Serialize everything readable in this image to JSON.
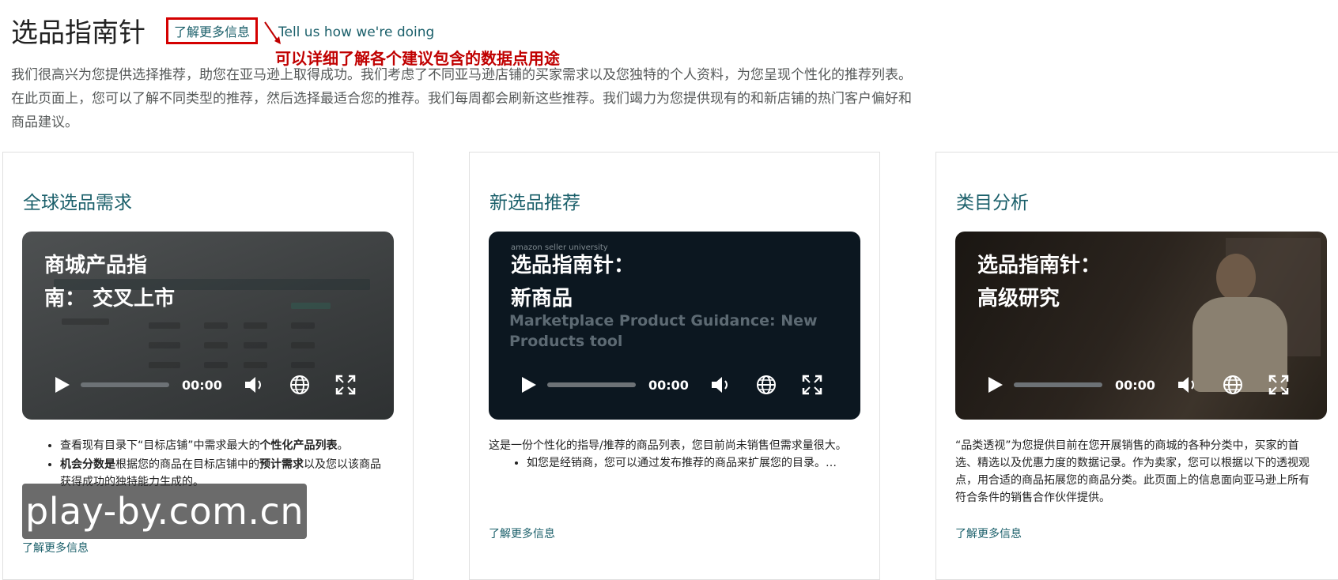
{
  "header": {
    "title": "选品指南针",
    "learn_more": "了解更多信息",
    "tell_us": "Tell us how we're doing",
    "annotation": "可以详细了解各个建议包含的数据点用途",
    "intro": "我们很高兴为您提供选择推荐，助您在亚马逊上取得成功。我们考虑了不同亚马逊店铺的买家需求以及您独特的个人资料，为您呈现个性化的推荐列表。在此页面上，您可以了解不同类型的推荐，然后选择最适合您的推荐。我们每周都会刷新这些推荐。我们竭力为您提供现有的和新店铺的热门客户偏好和商品建议。"
  },
  "cards": [
    {
      "title": "全球选品需求",
      "video": {
        "title": "商城产品指\n南：  交叉上市",
        "time": "00:00"
      },
      "bullets": [
        {
          "pre": "查看现有目录下“目标店铺”中需求最大的",
          "bold": "个性化产品列表",
          "post": "。"
        },
        {
          "bold": "机会分数是",
          "pre2": "根据您的商品在目标店铺中的",
          "bold2": "预计需求",
          "post": "以及您以该商品获得成功的独特能力生成的。"
        }
      ],
      "link": "了解更多信息"
    },
    {
      "title": "新选品推荐",
      "video": {
        "brand": "amazon seller university",
        "title": "选品指南针：\n新商品",
        "subtitle": "Marketplace Product Guidance: New\nProducts tool",
        "time": "00:00"
      },
      "desc": "这是一份个性化的指导/推荐的商品列表，您目前尚未销售但需求量很大。",
      "bullets": [
        "如您是经销商，您可以通过发布推荐的商品来扩展您的目录。…"
      ],
      "link": "了解更多信息"
    },
    {
      "title": "类目分析",
      "video": {
        "title": "选品指南针：\n高级研究",
        "time": "00:00"
      },
      "desc": "“品类透视”为您提供目前在您开展销售的商城的各种分类中，买家的首选、精选以及优惠力度的数据记录。作为卖家，您可以根据以下的透视观点，用合适的商品拓展您的商品分类。此页面上的信息面向亚马逊上所有符合条件的销售合作伙伴提供。",
      "link": "了解更多信息"
    }
  ],
  "watermark": "play-by.com.cn",
  "colors": {
    "link": "#1a5f6a",
    "annotation": "#c00000",
    "highlight_border": "#d40000"
  },
  "icons": [
    "play-icon",
    "volume-icon",
    "globe-icon",
    "fullscreen-icon",
    "red-arrow-icon"
  ]
}
